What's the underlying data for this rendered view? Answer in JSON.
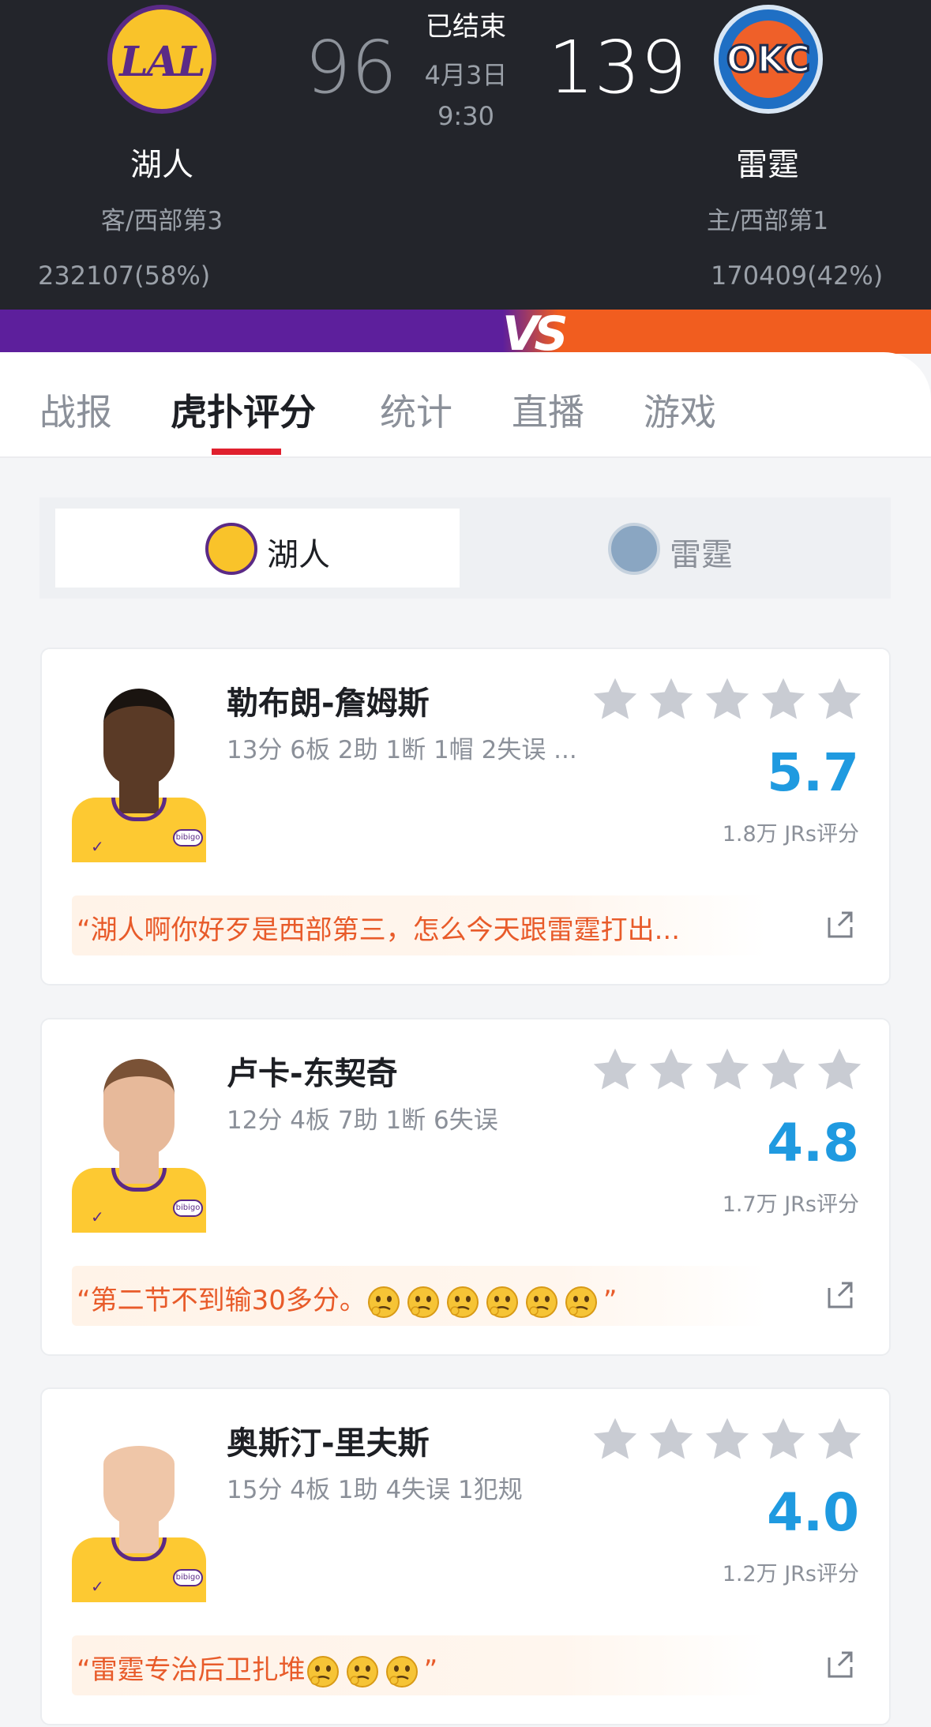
{
  "header": {
    "status": "已结束",
    "date": "4月3日",
    "time": "9:30",
    "away": {
      "name": "湖人",
      "rank": "客/西部第3",
      "votes": "232107(58%)",
      "score": "96",
      "logo_text": "LAL",
      "color": "#5b2a86",
      "accent": "#f9c32a"
    },
    "home": {
      "name": "雷霆",
      "rank": "主/西部第1",
      "votes": "170409(42%)",
      "score": "139",
      "logo_text": "OKC",
      "color": "#1f6fc4",
      "accent": "#ef6029"
    },
    "vs_label": "VS"
  },
  "tabs": [
    {
      "label": "战报",
      "active": false
    },
    {
      "label": "虎扑评分",
      "active": true
    },
    {
      "label": "统计",
      "active": false
    },
    {
      "label": "直播",
      "active": false
    },
    {
      "label": "游戏",
      "active": false
    }
  ],
  "team_switch": [
    {
      "label": "湖人",
      "logo_text": "LAL",
      "active": true
    },
    {
      "label": "雷霆",
      "logo_text": "OKC",
      "active": false
    }
  ],
  "players": [
    {
      "name": "勒布朗-詹姆斯",
      "stats": "13分 6板 2助 1断 1帽 2失误 ...",
      "rating": "5.7",
      "rating_count": "1.8万 JRs评分",
      "comment": "“湖人啊你好歹是西部第三，怎么今天跟雷霆打出...",
      "emoji_count": 0,
      "skin": "#5a3a26",
      "hair": "#1a1410",
      "sponsor": "bibigo"
    },
    {
      "name": "卢卡-东契奇",
      "stats": "12分 4板 7助 1断 6失误",
      "rating": "4.8",
      "rating_count": "1.7万 JRs评分",
      "comment": "“第二节不到输30多分。",
      "comment_end": "”",
      "emoji_count": 6,
      "skin": "#e7b99a",
      "hair": "#7a5236",
      "sponsor": "bibigo"
    },
    {
      "name": "奥斯汀-里夫斯",
      "stats": "15分 4板 1助 4失误 1犯规",
      "rating": "4.0",
      "rating_count": "1.2万 JRs评分",
      "comment": "“雷霆专治后卫扎堆",
      "comment_end": "”",
      "emoji_count": 3,
      "skin": "#efc6a8",
      "hair": "#ffffff",
      "sponsor": "bibigo"
    }
  ],
  "colors": {
    "rating": "#1f9ae0",
    "comment": "#e85b2a",
    "tab_underline": "#e0202e",
    "star": "#c9ccd3"
  }
}
